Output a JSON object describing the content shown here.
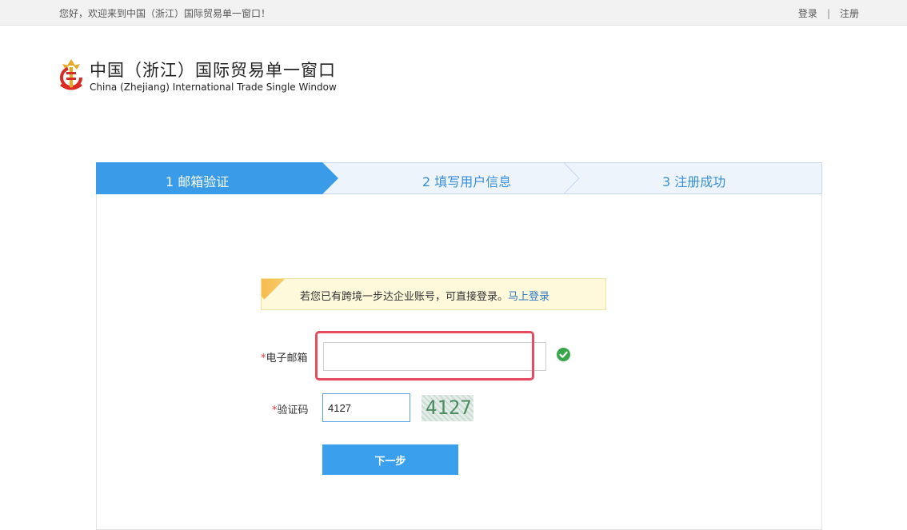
{
  "topbar": {
    "welcome": "您好，欢迎来到中国（浙江）国际贸易单一窗口！",
    "login": "登录",
    "separator": "|",
    "register": "注册"
  },
  "logo": {
    "title_cn": "中国（浙江）国际贸易单一窗口",
    "title_en": "China (Zhejiang) International Trade Single Window"
  },
  "steps": [
    {
      "label": "1 邮箱验证",
      "state": "active"
    },
    {
      "label": "2 填写用户信息",
      "state": "pending"
    },
    {
      "label": "3 注册成功",
      "state": "pending"
    }
  ],
  "notice": {
    "text": "若您已有跨境一步达企业账号，可直接登录。",
    "link": "马上登录"
  },
  "form": {
    "email": {
      "required_mark": "*",
      "label": "电子邮箱",
      "value": "",
      "status_icon": "check-circle-icon"
    },
    "code": {
      "required_mark": "*",
      "label": "验证码",
      "value": "4127",
      "captcha_text": "4127"
    },
    "next_label": "下一步"
  },
  "colors": {
    "accent": "#3aa0ed",
    "step_active": "#3a9be8",
    "step_inactive": "#eef4fc",
    "highlight": "#e84a5f",
    "success": "#3aa64a"
  }
}
